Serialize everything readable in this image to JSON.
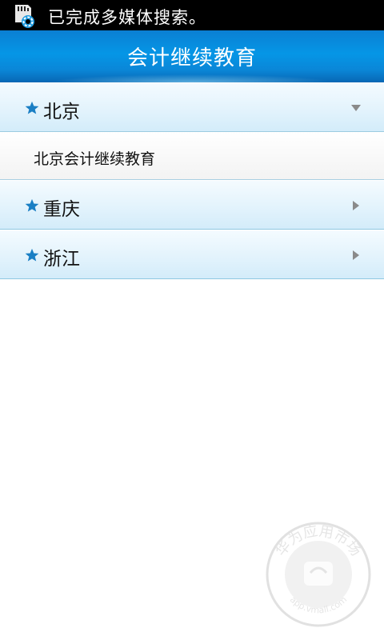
{
  "status_bar": {
    "icon": "sd-card-settings-icon",
    "message": "已完成多媒体搜索。"
  },
  "header": {
    "title": "会计继续教育"
  },
  "list": {
    "groups": [
      {
        "label": "北京",
        "expanded": true,
        "icon": "star-icon",
        "children": [
          "北京会计继续教育"
        ]
      },
      {
        "label": "重庆",
        "expanded": false,
        "icon": "star-icon",
        "children": []
      },
      {
        "label": "浙江",
        "expanded": false,
        "icon": "star-icon",
        "children": []
      }
    ]
  },
  "watermark": {
    "text_top": "华为应用市场",
    "text_bottom": "app.vmall.com"
  },
  "colors": {
    "header_blue": "#0596e6",
    "star_blue": "#1a7fc4",
    "row_bg": "#e3f3fc"
  }
}
